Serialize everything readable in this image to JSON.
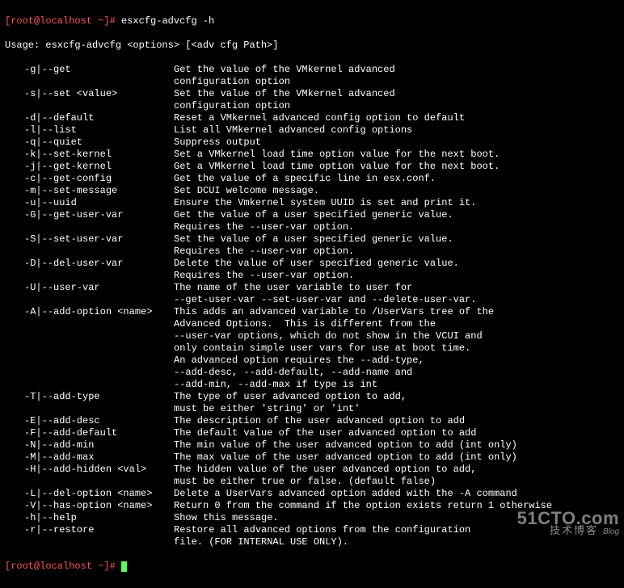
{
  "prompt1": {
    "user": "[root@localhost ~]#",
    "cmd": " esxcfg-advcfg -h"
  },
  "usage": "Usage: esxcfg-advcfg <options> [<adv cfg Path>]",
  "options": [
    {
      "flag": "-g|--get",
      "desc": [
        "Get the value of the VMkernel advanced",
        "configuration option"
      ]
    },
    {
      "flag": "-s|--set <value>",
      "desc": [
        "Set the value of the VMkernel advanced",
        "configuration option"
      ]
    },
    {
      "flag": "-d|--default",
      "desc": [
        "Reset a VMkernel advanced config option to default"
      ]
    },
    {
      "flag": "-l|--list",
      "desc": [
        "List all VMkernel advanced config options"
      ]
    },
    {
      "flag": "-q|--quiet",
      "desc": [
        "Suppress output"
      ]
    },
    {
      "flag": "-k|--set-kernel",
      "desc": [
        "Set a VMkernel load time option value for the next boot."
      ]
    },
    {
      "flag": "-j|--get-kernel",
      "desc": [
        "Get a VMkernel load time option value for the next boot."
      ]
    },
    {
      "flag": "-c|--get-config",
      "desc": [
        "Get the value of a specific line in esx.conf."
      ]
    },
    {
      "flag": "-m|--set-message",
      "desc": [
        "Set DCUI welcome message."
      ]
    },
    {
      "flag": "-u|--uuid",
      "desc": [
        "Ensure the Vmkernel system UUID is set and print it."
      ]
    },
    {
      "flag": "-G|--get-user-var",
      "desc": [
        "Get the value of a user specified generic value.",
        "Requires the --user-var option."
      ]
    },
    {
      "flag": "-S|--set-user-var",
      "desc": [
        "Set the value of a user specified generic value.",
        "Requires the --user-var option."
      ]
    },
    {
      "flag": "-D|--del-user-var",
      "desc": [
        "Delete the value of user specified generic value.",
        "Requires the --user-var option."
      ]
    },
    {
      "flag": "-U|--user-var",
      "desc": [
        "The name of the user variable to user for",
        "--get-user-var --set-user-var and --delete-user-var."
      ]
    },
    {
      "flag": "-A|--add-option <name>",
      "desc": [
        "This adds an advanced variable to /UserVars tree of the",
        "Advanced Options.  This is different from the",
        "--user-var options, which do not show in the VCUI and",
        "only contain simple user vars for use at boot time.",
        "An advanced option requires the --add-type,",
        "--add-desc, --add-default, --add-name and",
        "--add-min, --add-max if type is int"
      ]
    },
    {
      "flag": "-T|--add-type",
      "desc": [
        "The type of user advanced option to add,",
        "must be either 'string' or 'int'"
      ]
    },
    {
      "flag": "-E|--add-desc",
      "desc": [
        "The description of the user advanced option to add"
      ]
    },
    {
      "flag": "-F|--add-default",
      "desc": [
        "The default value of the user advanced option to add"
      ]
    },
    {
      "flag": "-N|--add-min",
      "desc": [
        "The min value of the user advanced option to add (int only)"
      ]
    },
    {
      "flag": "-M|--add-max",
      "desc": [
        "The max value of the user advanced option to add (int only)"
      ]
    },
    {
      "flag": "-H|--add-hidden <val>",
      "desc": [
        "The hidden value of the user advanced option to add,",
        "must be either true or false. (default false)"
      ]
    },
    {
      "flag": "-L|--del-option <name>",
      "desc": [
        "Delete a UserVars advanced option added with the -A command"
      ]
    },
    {
      "flag": "-V|--has-option <name>",
      "desc": [
        "Return 0 from the command if the option exists return 1 otherwise"
      ]
    },
    {
      "flag": "-h|--help",
      "desc": [
        "Show this message."
      ]
    },
    {
      "flag": "-r|--restore",
      "desc": [
        "Restore all advanced options from the configuration",
        "file. (FOR INTERNAL USE ONLY)."
      ]
    }
  ],
  "prompt2": {
    "user": "[root@localhost ~]#",
    "cmd": " "
  },
  "watermark": {
    "domain": "51CTO.com",
    "sub": "技术博客",
    "blog": "Blog"
  }
}
